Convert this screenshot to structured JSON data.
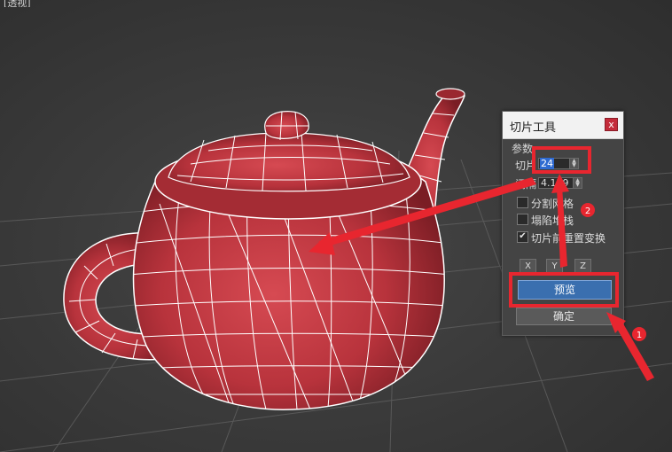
{
  "viewport": {
    "label": "[透视]",
    "colors": {
      "teapot": "#c23a43",
      "wire": "#ffffff",
      "grid": "#6a6a6a"
    }
  },
  "dialog": {
    "title": "切片工具",
    "close_label": "x",
    "group_label": "参数",
    "slices_label": "切片",
    "slices_value": "24",
    "interval_label": "间隔",
    "interval_value": "4.179",
    "checkboxes": [
      {
        "label": "分割网格",
        "checked": false
      },
      {
        "label": "塌陷堆栈",
        "checked": false
      },
      {
        "label": "切片前重置变换",
        "checked": true
      }
    ],
    "axis_buttons": [
      "X",
      "Y",
      "Z"
    ],
    "preview_label": "预览",
    "ok_label": "确定"
  },
  "annotations": {
    "highlight_color": "#e8262f",
    "badges": [
      "1",
      "2"
    ]
  }
}
